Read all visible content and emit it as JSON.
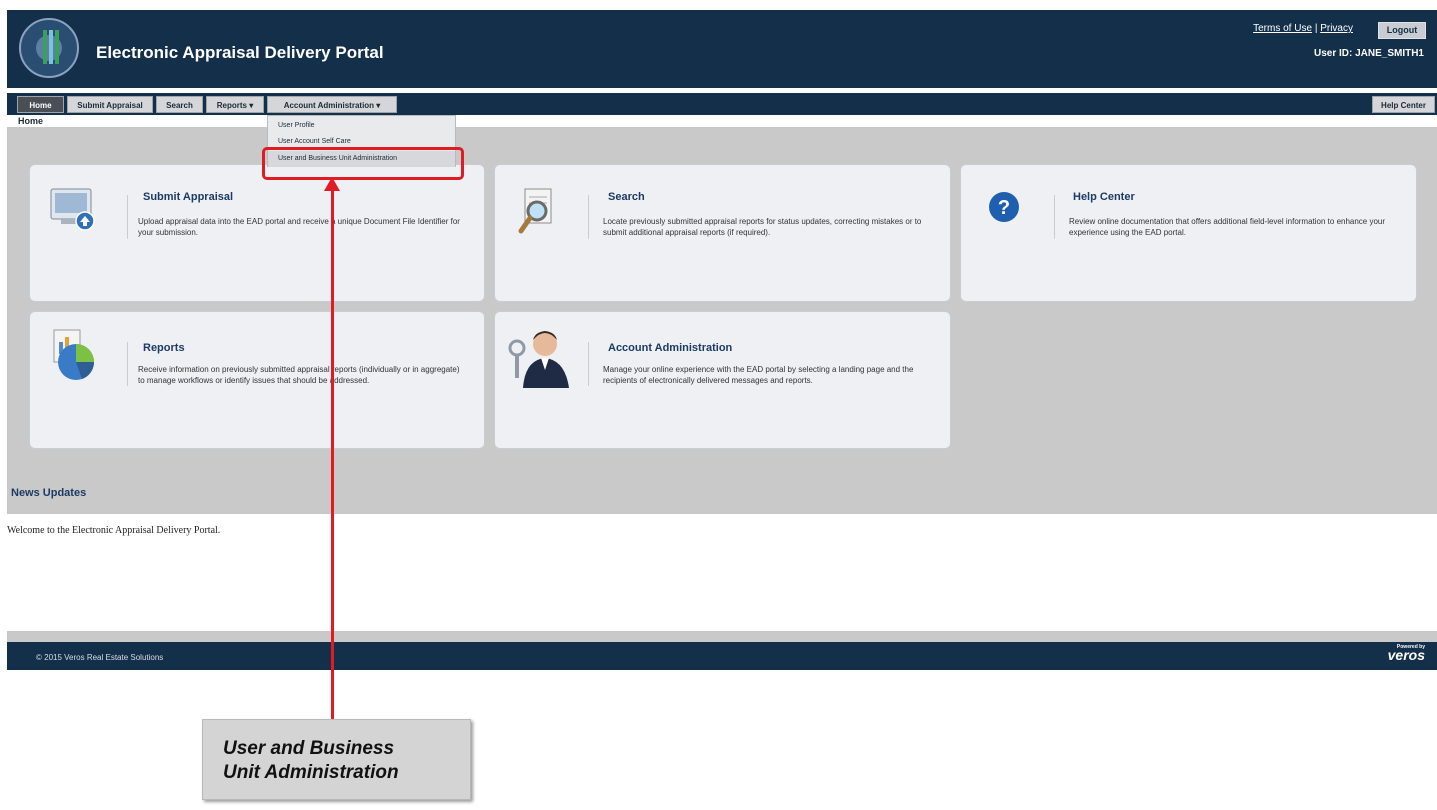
{
  "header": {
    "title": "Electronic Appraisal Delivery Portal",
    "terms_link": "Terms of Use",
    "privacy_link": "Privacy",
    "separator": "|",
    "logout_label": "Logout",
    "user_id": "User ID: JANE_SMITH1",
    "seal_icon": "hud-seal-icon"
  },
  "nav": {
    "tabs": [
      {
        "label": "Home",
        "active": true
      },
      {
        "label": "Submit Appraisal"
      },
      {
        "label": "Search"
      },
      {
        "label": "Reports ▾"
      },
      {
        "label": "Account Administration ▾"
      }
    ],
    "help_center": "Help Center"
  },
  "breadcrumb": "Home",
  "dropdown": {
    "items": [
      "User Profile",
      "User Account Self Care",
      "User and Business Unit Administration"
    ]
  },
  "cards": [
    {
      "title": "Submit Appraisal",
      "desc": "Upload appraisal data into the EAD portal and receive a unique Document File Identifier for your submission.",
      "icon": "upload-computer-icon"
    },
    {
      "title": "Search",
      "desc": "Locate previously submitted appraisal reports for status updates, correcting mistakes or to submit additional appraisal reports (if required).",
      "icon": "magnifier-document-icon"
    },
    {
      "title": "Help Center",
      "desc": "Review online documentation that offers additional field-level information to enhance your experience using the EAD portal.",
      "icon": "question-mark-icon"
    },
    {
      "title": "Reports",
      "desc": "Receive information on previously submitted appraisal reports (individually or in aggregate) to manage workflows or identify issues that should be addressed.",
      "icon": "pie-chart-report-icon"
    },
    {
      "title": "Account Administration",
      "desc": "Manage your online experience with the EAD portal by selecting a landing page and the recipients of electronically delivered messages and reports.",
      "icon": "user-key-icon"
    }
  ],
  "news": {
    "title": "News Updates",
    "text": "Welcome to the Electronic Appraisal Delivery Portal."
  },
  "footer": {
    "copyright": "© 2015 Veros Real Estate Solutions",
    "logo_text": "veros",
    "logo_small": "Powered by"
  },
  "callout": {
    "line1": "User and Business",
    "line2": "Unit Administration"
  },
  "colors": {
    "header": "#132f49",
    "content": "#c9c9c9",
    "annotation": "#e01b24"
  }
}
